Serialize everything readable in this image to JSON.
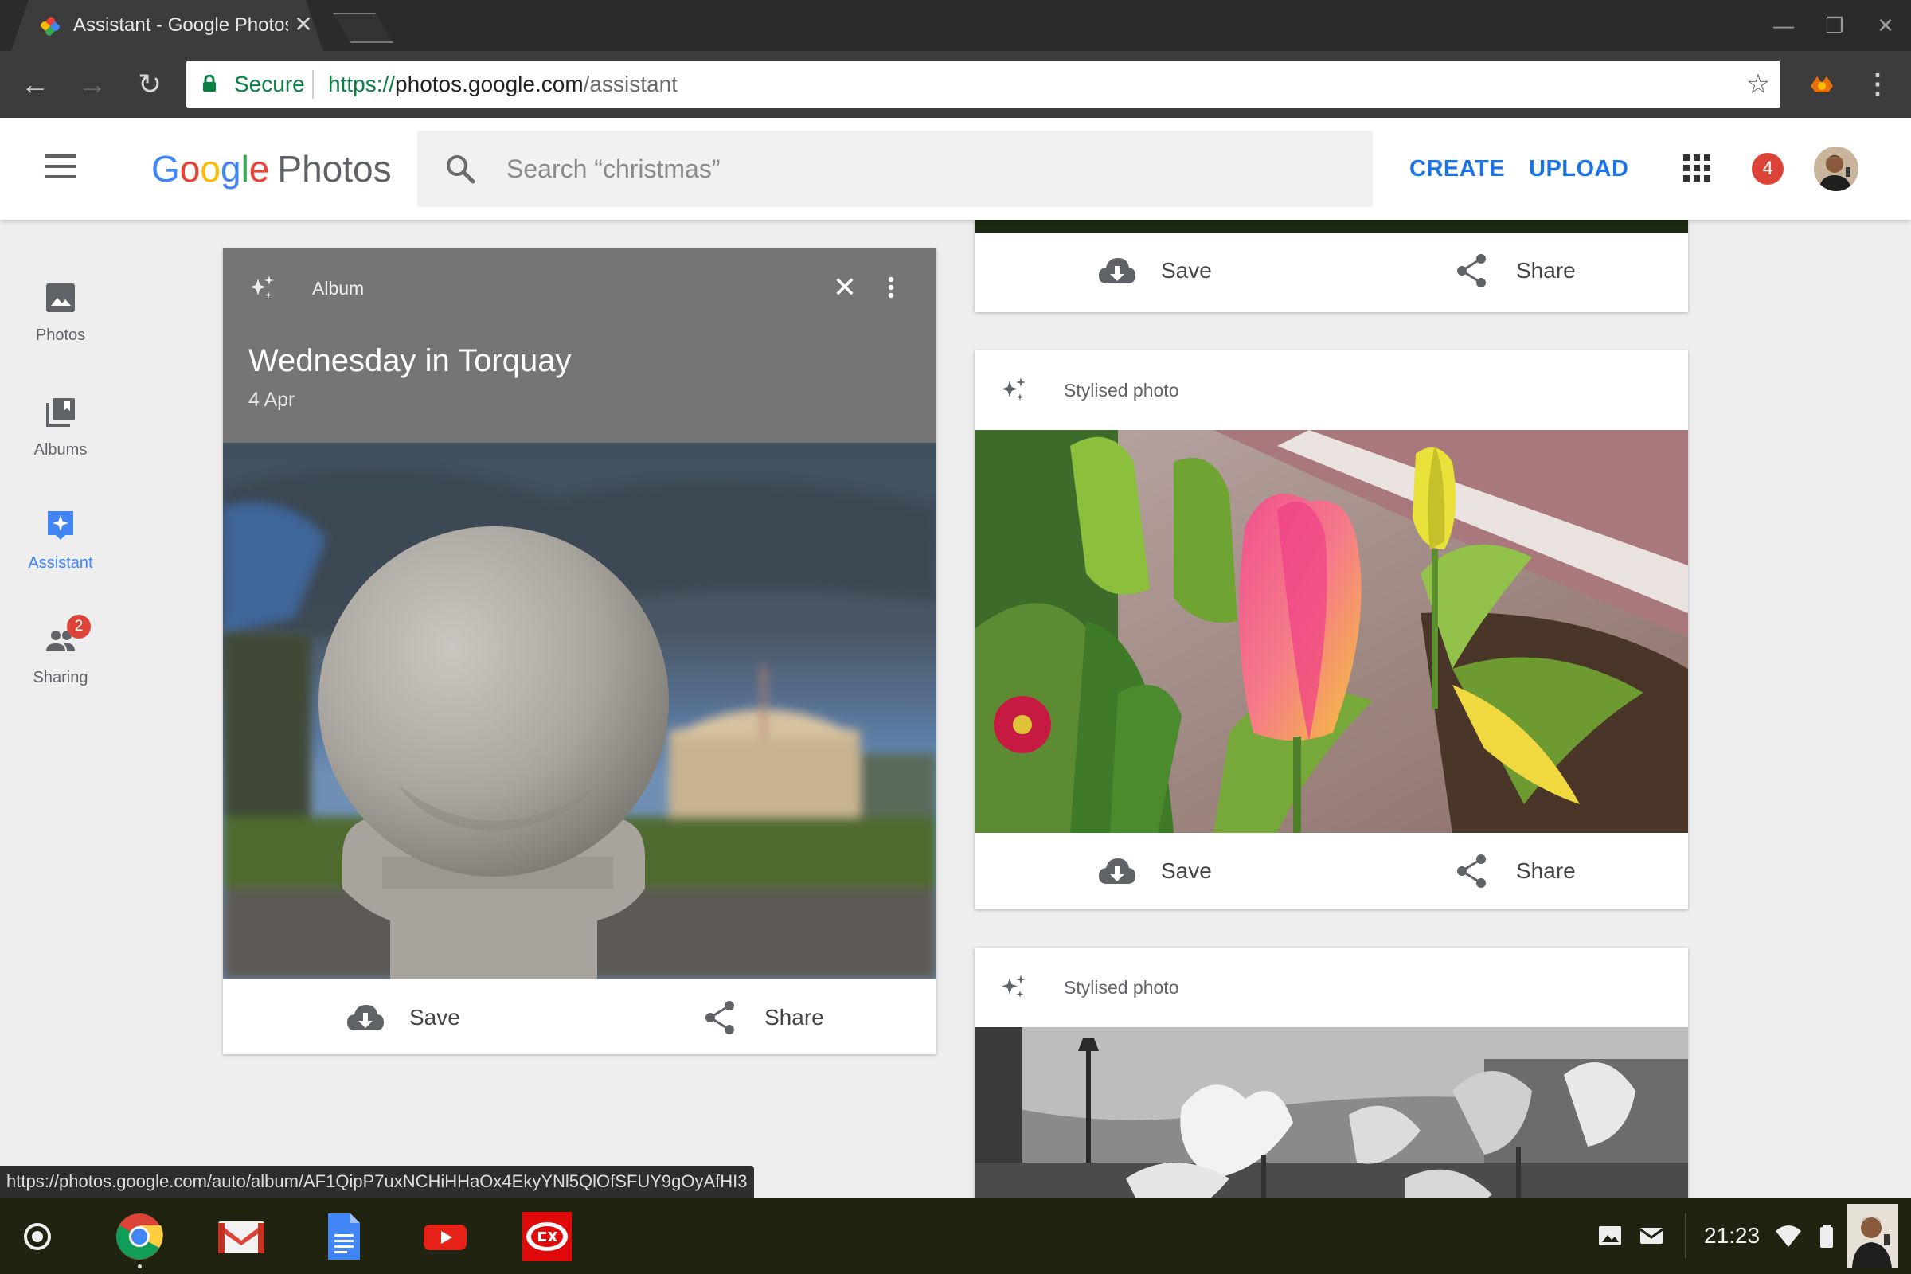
{
  "browser": {
    "tab_title": "Assistant - Google Photos",
    "tab_close": "✕",
    "secure_label": "Secure",
    "url_scheme": "https://",
    "url_host": "photos.google.com",
    "url_path": "/assistant",
    "back": "←",
    "forward": "→",
    "reload": "↻",
    "bookmark_star": "☆",
    "menu": "⋮",
    "minimize": "—",
    "restore": "❐",
    "close": "✕"
  },
  "header": {
    "logo_letters": [
      "G",
      "o",
      "o",
      "g",
      "l",
      "e"
    ],
    "logo_colors": [
      "#4285f4",
      "#ea4335",
      "#fbbc05",
      "#4285f4",
      "#34a853",
      "#ea4335"
    ],
    "logo_product": "Photos",
    "search_placeholder": "Search “christmas”",
    "create_label": "CREATE",
    "upload_label": "UPLOAD",
    "notification_count": "4"
  },
  "sidebar": {
    "items": [
      {
        "label": "Photos",
        "icon": "photo-icon"
      },
      {
        "label": "Albums",
        "icon": "albums-icon"
      },
      {
        "label": "Assistant",
        "icon": "assistant-icon",
        "active": true
      },
      {
        "label": "Sharing",
        "icon": "people-icon",
        "badge": "2"
      }
    ]
  },
  "album_card": {
    "tag": "Album",
    "title": "Wednesday in Torquay",
    "date": "4 Apr",
    "close": "✕",
    "save_label": "Save",
    "share_label": "Share"
  },
  "top_card": {
    "save_label": "Save",
    "share_label": "Share"
  },
  "tulip_card": {
    "tag": "Stylised photo",
    "save_label": "Save",
    "share_label": "Share"
  },
  "bw_card": {
    "tag": "Stylised photo"
  },
  "status_url": "https://photos.google.com/auto/album/AF1QipP7uxNCHiHHaOx4EkyYNl5QlOfSFUY9gOyAfHI3",
  "shelf": {
    "apps": [
      "chrome-icon",
      "gmail-icon",
      "docs-icon",
      "youtube-icon",
      "cex-icon"
    ],
    "clock": "21:23"
  },
  "colors": {
    "accent": "#1a73e8",
    "badge": "#db4437",
    "secure": "#0b8043"
  }
}
